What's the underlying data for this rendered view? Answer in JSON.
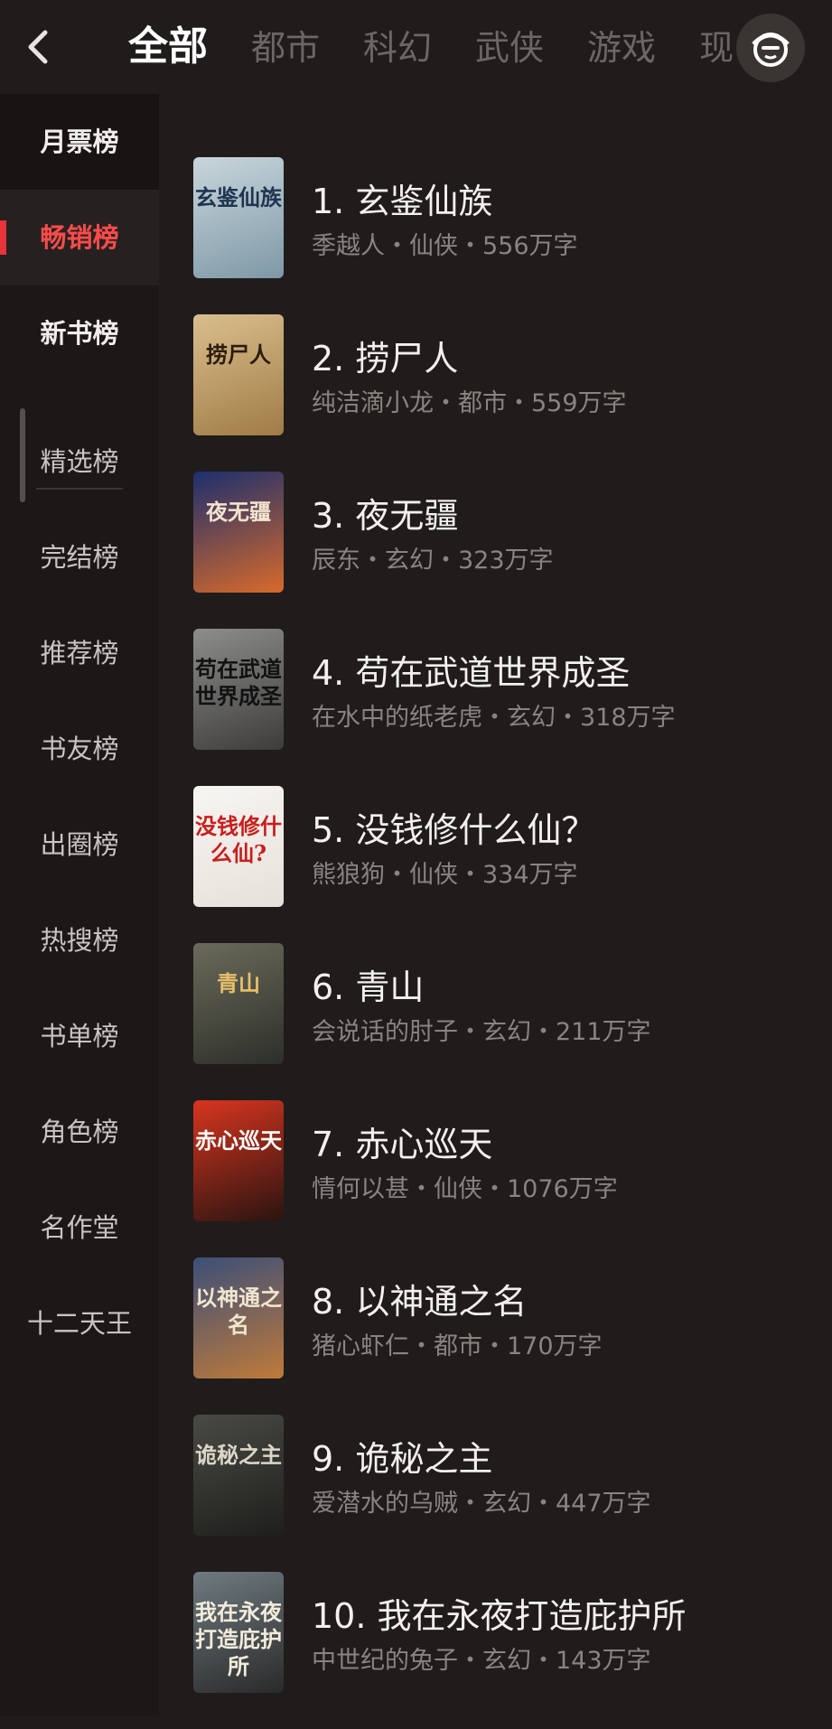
{
  "header": {
    "tabs": [
      "全部",
      "都市",
      "科幻",
      "武侠",
      "游戏",
      "现"
    ],
    "active_tab": 0
  },
  "sidebar": {
    "items": [
      "月票榜",
      "畅销榜",
      "新书榜",
      "精选榜",
      "完结榜",
      "推荐榜",
      "书友榜",
      "出圈榜",
      "热搜榜",
      "书单榜",
      "角色榜",
      "名作堂",
      "十二天王"
    ],
    "active_index": 1
  },
  "books": [
    {
      "title": "1. 玄鉴仙族",
      "author": "季越人",
      "genre": "仙侠",
      "words": "556万字",
      "cover_text": "玄鉴仙族",
      "cover_colors": [
        "#c9d6dc",
        "#7e98a6"
      ],
      "cover_ink": "#1f3550"
    },
    {
      "title": "2. 捞尸人",
      "author": "纯洁滴小龙",
      "genre": "都市",
      "words": "559万字",
      "cover_text": "捞尸人",
      "cover_colors": [
        "#d9bf8e",
        "#a07b45"
      ],
      "cover_ink": "#2b1c10"
    },
    {
      "title": "3. 夜无疆",
      "author": "辰东",
      "genre": "玄幻",
      "words": "323万字",
      "cover_text": "夜无疆",
      "cover_colors": [
        "#1c2f6e",
        "#d86a2a"
      ],
      "cover_ink": "#f3e3cf"
    },
    {
      "title": "4. 苟在武道世界成圣",
      "author": "在水中的纸老虎",
      "genre": "玄幻",
      "words": "318万字",
      "cover_text": "苟在武道世界成圣",
      "cover_colors": [
        "#8d8d8b",
        "#3d3c3b"
      ],
      "cover_ink": "#111111"
    },
    {
      "title": "5. 没钱修什么仙？",
      "author": "熊狼狗",
      "genre": "仙侠",
      "words": "334万字",
      "cover_text": "没钱修什么仙?",
      "cover_colors": [
        "#f7f5f2",
        "#e6e1da"
      ],
      "cover_ink": "#c81e1e"
    },
    {
      "title": "6. 青山",
      "author": "会说话的肘子",
      "genre": "玄幻",
      "words": "211万字",
      "cover_text": "青山",
      "cover_colors": [
        "#6b6a5a",
        "#2d2f2a"
      ],
      "cover_ink": "#e8c06a"
    },
    {
      "title": "7. 赤心巡天",
      "author": "情何以甚",
      "genre": "仙侠",
      "words": "1076万字",
      "cover_text": "赤心巡天",
      "cover_colors": [
        "#d8351f",
        "#2a1410"
      ],
      "cover_ink": "#ffffff"
    },
    {
      "title": "8. 以神通之名",
      "author": "猪心虾仁",
      "genre": "都市",
      "words": "170万字",
      "cover_text": "以神通之名",
      "cover_colors": [
        "#3c4f78",
        "#bf7a3a"
      ],
      "cover_ink": "#f0e6d0"
    },
    {
      "title": "9. 诡秘之主",
      "author": "爱潜水的乌贼",
      "genre": "玄幻",
      "words": "447万字",
      "cover_text": "诡秘之主",
      "cover_colors": [
        "#4a4a44",
        "#1e1f1c"
      ],
      "cover_ink": "#dcd6c8"
    },
    {
      "title": "10. 我在永夜打造庇护所",
      "author": "中世纪的兔子",
      "genre": "玄幻",
      "words": "143万字",
      "cover_text": "我在永夜打造庇护所",
      "cover_colors": [
        "#6f7b80",
        "#2a2a2a"
      ],
      "cover_ink": "#f3ecdc"
    }
  ],
  "separator": "・",
  "colors": {
    "accent": "#e8323c",
    "background": "#201c1b"
  }
}
